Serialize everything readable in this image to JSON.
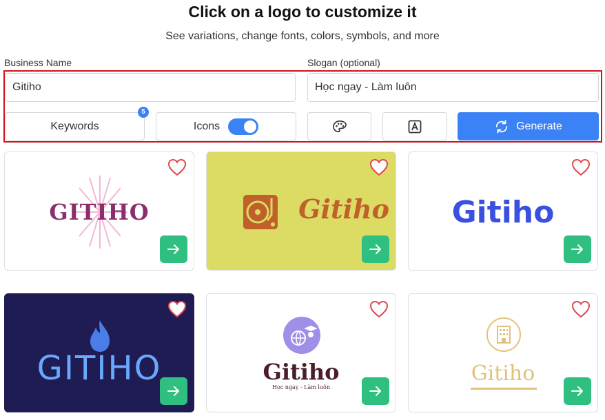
{
  "header": {
    "title": "Click on a logo to customize it",
    "subtitle": "See variations, change fonts, colors, symbols, and more"
  },
  "form": {
    "business_name_label": "Business Name",
    "business_name_value": "Gitiho",
    "slogan_label": "Slogan (optional)",
    "slogan_value": "Học ngay - Làm luôn",
    "keywords_label": "Keywords",
    "keywords_count": "5",
    "icons_label": "Icons",
    "icons_toggle_on": true,
    "palette_icon": "palette-icon",
    "font_icon": "font-icon",
    "generate_label": "Generate",
    "generate_icon": "refresh-icon"
  },
  "colors": {
    "accent": "#3b82f6",
    "go_button": "#2fbf80",
    "highlight": "#d0121b",
    "heart": "#e0474c"
  },
  "logos": [
    {
      "text": "GITIHO",
      "slogan": "",
      "background": "#ffffff",
      "text_color": "#8a2f6a",
      "icon": "starburst-icon"
    },
    {
      "text": "Gitiho",
      "slogan": "",
      "background": "#dcdb63",
      "text_color": "#c0602a",
      "icon": "turntable-icon"
    },
    {
      "text": "Gitiho",
      "slogan": "",
      "background": "#ffffff",
      "text_color": "#3c50e0",
      "icon": ""
    },
    {
      "text": "GITIHO",
      "slogan": "",
      "background": "#1e1c52",
      "text_color": "#6aa8ff",
      "icon": "flame-icon"
    },
    {
      "text": "Gitiho",
      "slogan": "Học ngay - Làm luôn",
      "background": "#ffffff",
      "text_color": "#4a1e2a",
      "icon": "graduate-globe-icon"
    },
    {
      "text": "Gitiho",
      "slogan": "",
      "background": "#ffffff",
      "text_color": "#e2c27a",
      "icon": "building-icon"
    }
  ]
}
